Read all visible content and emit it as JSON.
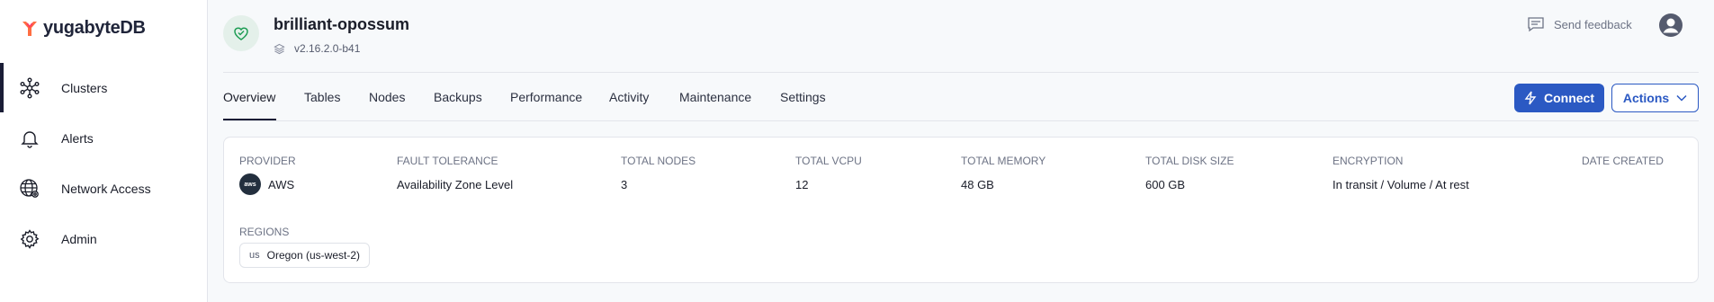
{
  "app": {
    "logo_text": "yugabyteDB"
  },
  "sidebar": {
    "items": [
      {
        "label": "Clusters",
        "icon": "clusters-icon",
        "active": true
      },
      {
        "label": "Alerts",
        "icon": "bell-icon",
        "active": false
      },
      {
        "label": "Network Access",
        "icon": "globe-network-icon",
        "active": false
      },
      {
        "label": "Admin",
        "icon": "gear-icon",
        "active": false
      }
    ]
  },
  "header": {
    "cluster_name": "brilliant-opossum",
    "version": "v2.16.2.0-b41",
    "status_icon": "heart-check-icon",
    "feedback_label": "Send feedback"
  },
  "tabs": [
    {
      "label": "Overview",
      "active": true
    },
    {
      "label": "Tables"
    },
    {
      "label": "Nodes"
    },
    {
      "label": "Backups"
    },
    {
      "label": "Performance"
    },
    {
      "label": "Activity"
    },
    {
      "label": "Maintenance"
    },
    {
      "label": "Settings"
    }
  ],
  "actions": {
    "connect_label": "Connect",
    "actions_label": "Actions"
  },
  "overview": {
    "provider": {
      "label": "PROVIDER",
      "value": "AWS",
      "badge": "aws"
    },
    "fault_tolerance": {
      "label": "FAULT TOLERANCE",
      "value": "Availability Zone Level"
    },
    "total_nodes": {
      "label": "TOTAL NODES",
      "value": "3"
    },
    "total_vcpu": {
      "label": "TOTAL vCPU",
      "value": "12"
    },
    "total_memory": {
      "label": "TOTAL MEMORY",
      "value": "48 GB"
    },
    "total_disk": {
      "label": "TOTAL DISK SIZE",
      "value": "600 GB"
    },
    "encryption": {
      "label": "ENCRYPTION",
      "value": "In transit / Volume / At rest"
    },
    "date_created": {
      "label": "DATE CREATED",
      "value": ""
    },
    "regions": {
      "label": "REGIONS",
      "items": [
        {
          "code": "us",
          "name": "Oregon (us-west-2)"
        }
      ]
    }
  },
  "colors": {
    "accent": "#2b59c3",
    "nav_active": "#1a1d36",
    "status_green": "#1f9d55",
    "logo_orange": "#ff6e42"
  }
}
